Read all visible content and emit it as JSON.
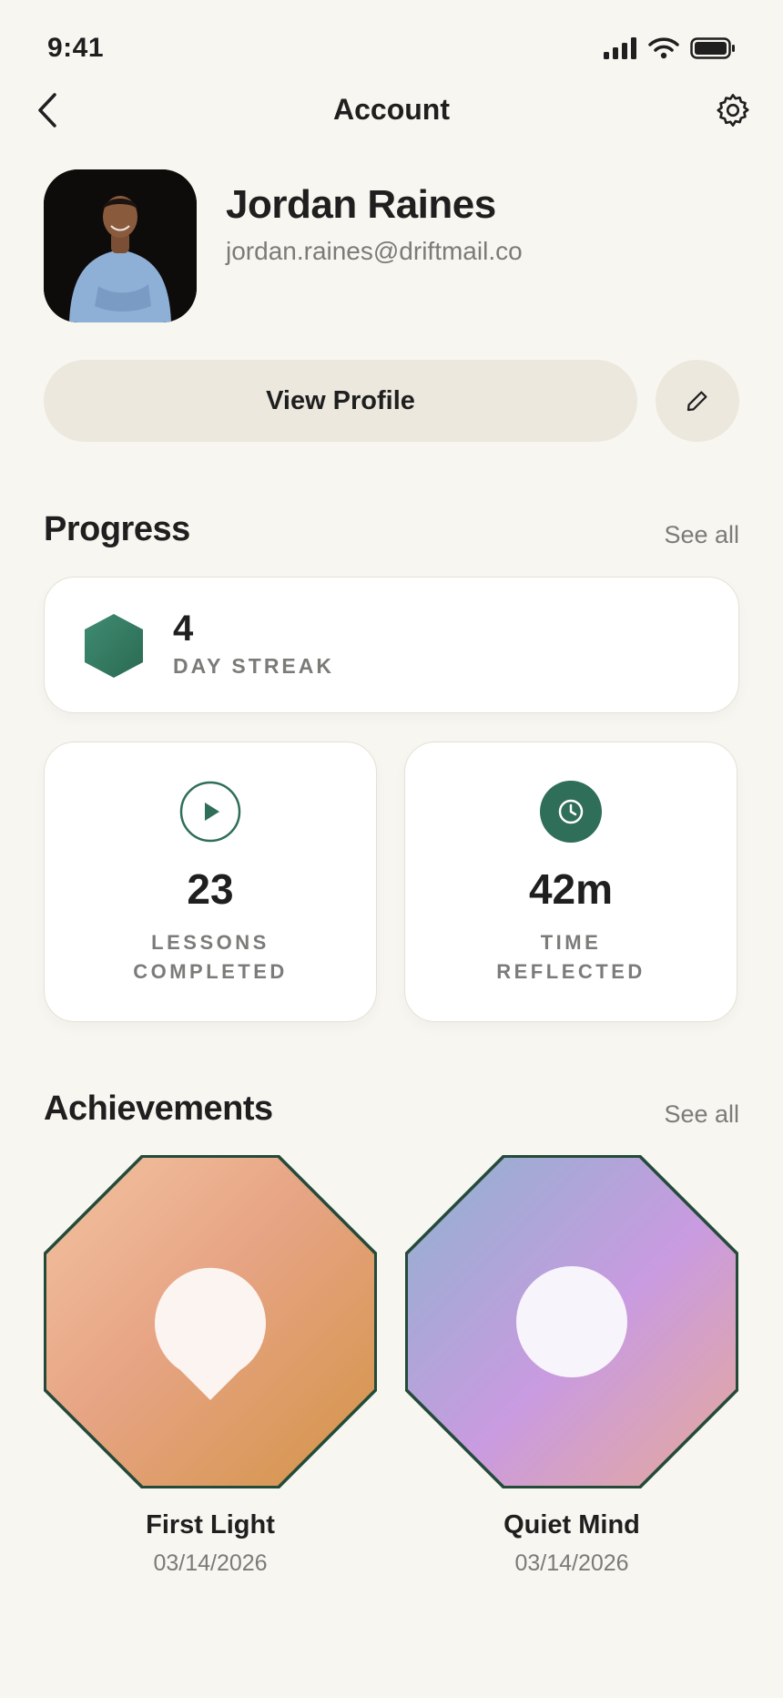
{
  "status_bar": {
    "time": "9:41"
  },
  "header": {
    "title": "Account"
  },
  "profile": {
    "name": "Jordan Raines",
    "email": "jordan.raines@driftmail.co",
    "view_profile_label": "View Profile"
  },
  "progress": {
    "title": "Progress",
    "see_all": "See all",
    "streak": {
      "value": "4",
      "label": "DAY STREAK"
    },
    "stats": [
      {
        "value": "23",
        "label_line1": "LESSONS",
        "label_line2": "COMPLETED"
      },
      {
        "value": "42m",
        "label_line1": "TIME",
        "label_line2": "REFLECTED"
      }
    ]
  },
  "achievements": {
    "title": "Achievements",
    "see_all": "See all",
    "items": [
      {
        "title": "First Light",
        "date": "03/14/2026"
      },
      {
        "title": "Quiet Mind",
        "date": "03/14/2026"
      }
    ]
  },
  "colors": {
    "background": "#f8f6f1",
    "accent_green": "#2f6e58",
    "pill": "#ece8de",
    "muted_text": "#7b7b78"
  },
  "icons": [
    "back-chevron-icon",
    "gear-icon",
    "pencil-icon",
    "hexagon-icon",
    "play-icon",
    "clock-icon",
    "signal-icon",
    "wifi-icon",
    "battery-icon"
  ]
}
